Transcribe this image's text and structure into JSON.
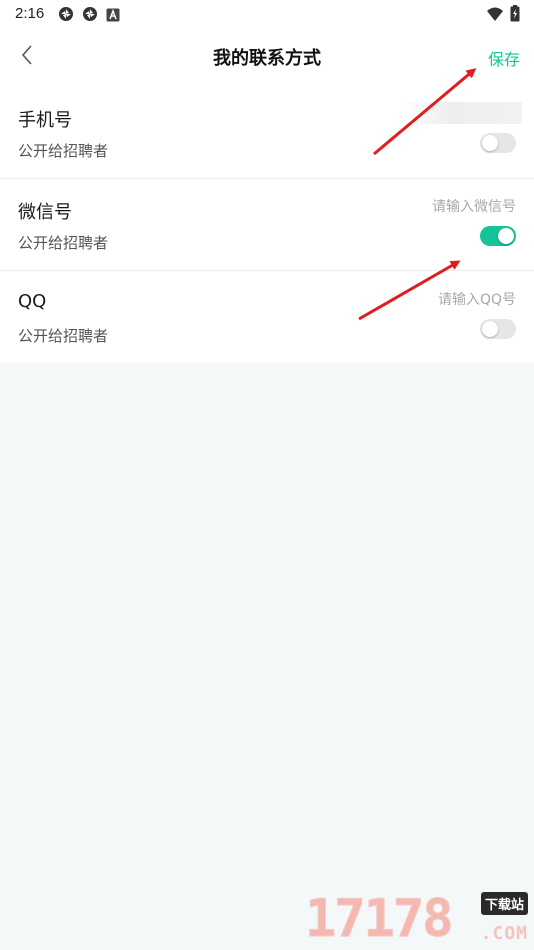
{
  "status_bar": {
    "time": "2:16",
    "left_icons": [
      "aperture-icon",
      "aperture-icon",
      "app-a-icon"
    ],
    "right_icons": [
      "wifi-icon",
      "battery-charging-icon"
    ]
  },
  "nav": {
    "title": "我的联系方式",
    "save_label": "保存",
    "back_icon": "chevron-left-icon"
  },
  "rows": [
    {
      "title": "手机号",
      "sub": "公开给招聘者",
      "value": "",
      "placeholder": "",
      "public": false
    },
    {
      "title": "微信号",
      "sub": "公开给招聘者",
      "value": "",
      "placeholder": "请输入微信号",
      "public": true
    },
    {
      "title": "QQ",
      "sub": "公开给招聘者",
      "value": "",
      "placeholder": "请输入QQ号",
      "public": false
    }
  ],
  "watermark": {
    "number": "17178",
    "badge": "下载站",
    "suffix": ".COM"
  },
  "colors": {
    "accent": "#15c39a",
    "arrow": "#e01e1e",
    "page_bg": "#f5f8f8",
    "toggle_off": "#e6e6e6"
  }
}
